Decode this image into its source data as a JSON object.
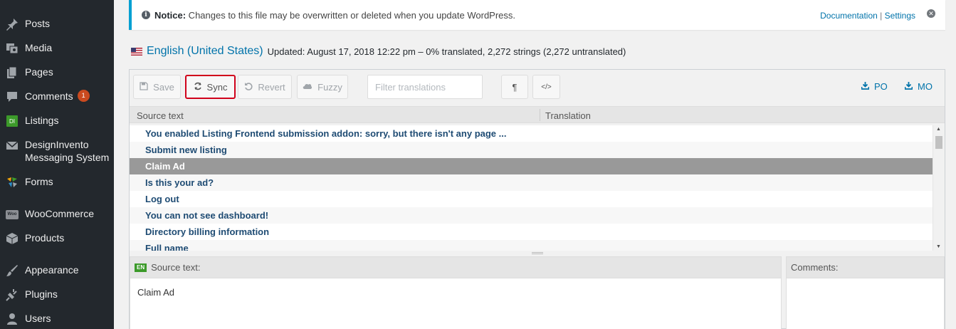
{
  "sidebar": {
    "items": [
      {
        "label": "Posts",
        "icon": "pushpin-icon"
      },
      {
        "label": "Media",
        "icon": "media-icon"
      },
      {
        "label": "Pages",
        "icon": "pages-icon"
      },
      {
        "label": "Comments",
        "icon": "comment-icon",
        "badge": "1"
      },
      {
        "label": "Listings",
        "icon": "di-icon",
        "icon_text": "DI"
      },
      {
        "label": "DesignInvento",
        "label2": "Messaging System",
        "icon": "mail-icon"
      },
      {
        "label": "Forms",
        "icon": "forms-icon"
      },
      {
        "label": "WooCommerce",
        "icon": "woo-icon",
        "icon_text": "Woo"
      },
      {
        "label": "Products",
        "icon": "products-icon"
      },
      {
        "label": "Appearance",
        "icon": "brush-icon"
      },
      {
        "label": "Plugins",
        "icon": "plugin-icon"
      },
      {
        "label": "Users",
        "icon": "user-icon"
      }
    ],
    "bg_color": "#23282d"
  },
  "notice": {
    "prefix": "Notice:",
    "message": " Changes to this file may be overwritten or deleted when you update WordPress.",
    "documentation": "Documentation",
    "separator": "|",
    "settings": "Settings",
    "accent_color": "#00a0d2"
  },
  "locale": {
    "name": "English (United States)",
    "info": "Updated: August 17, 2018 12:22 pm – 0% translated, 2,272 strings (2,272 untranslated)"
  },
  "toolbar": {
    "save": "Save",
    "sync": "Sync",
    "revert": "Revert",
    "fuzzy": "Fuzzy",
    "filter_placeholder": "Filter translations",
    "pilcrow": "¶",
    "code": "</>",
    "po": "PO",
    "mo": "MO"
  },
  "columns": {
    "source": "Source text",
    "translation": "Translation"
  },
  "strings": [
    "You enabled Listing Frontend submission addon: sorry, but there isn't any page ...",
    "Submit new listing",
    "Claim Ad",
    "Is this your ad?",
    "Log out",
    "You can not see dashboard!",
    "Directory billing information",
    "Full name"
  ],
  "selected_index": 2,
  "source_pane": {
    "lang_tag": "EN",
    "title": "Source text:",
    "text": "Claim Ad"
  },
  "comments_pane": {
    "title": "Comments:"
  }
}
